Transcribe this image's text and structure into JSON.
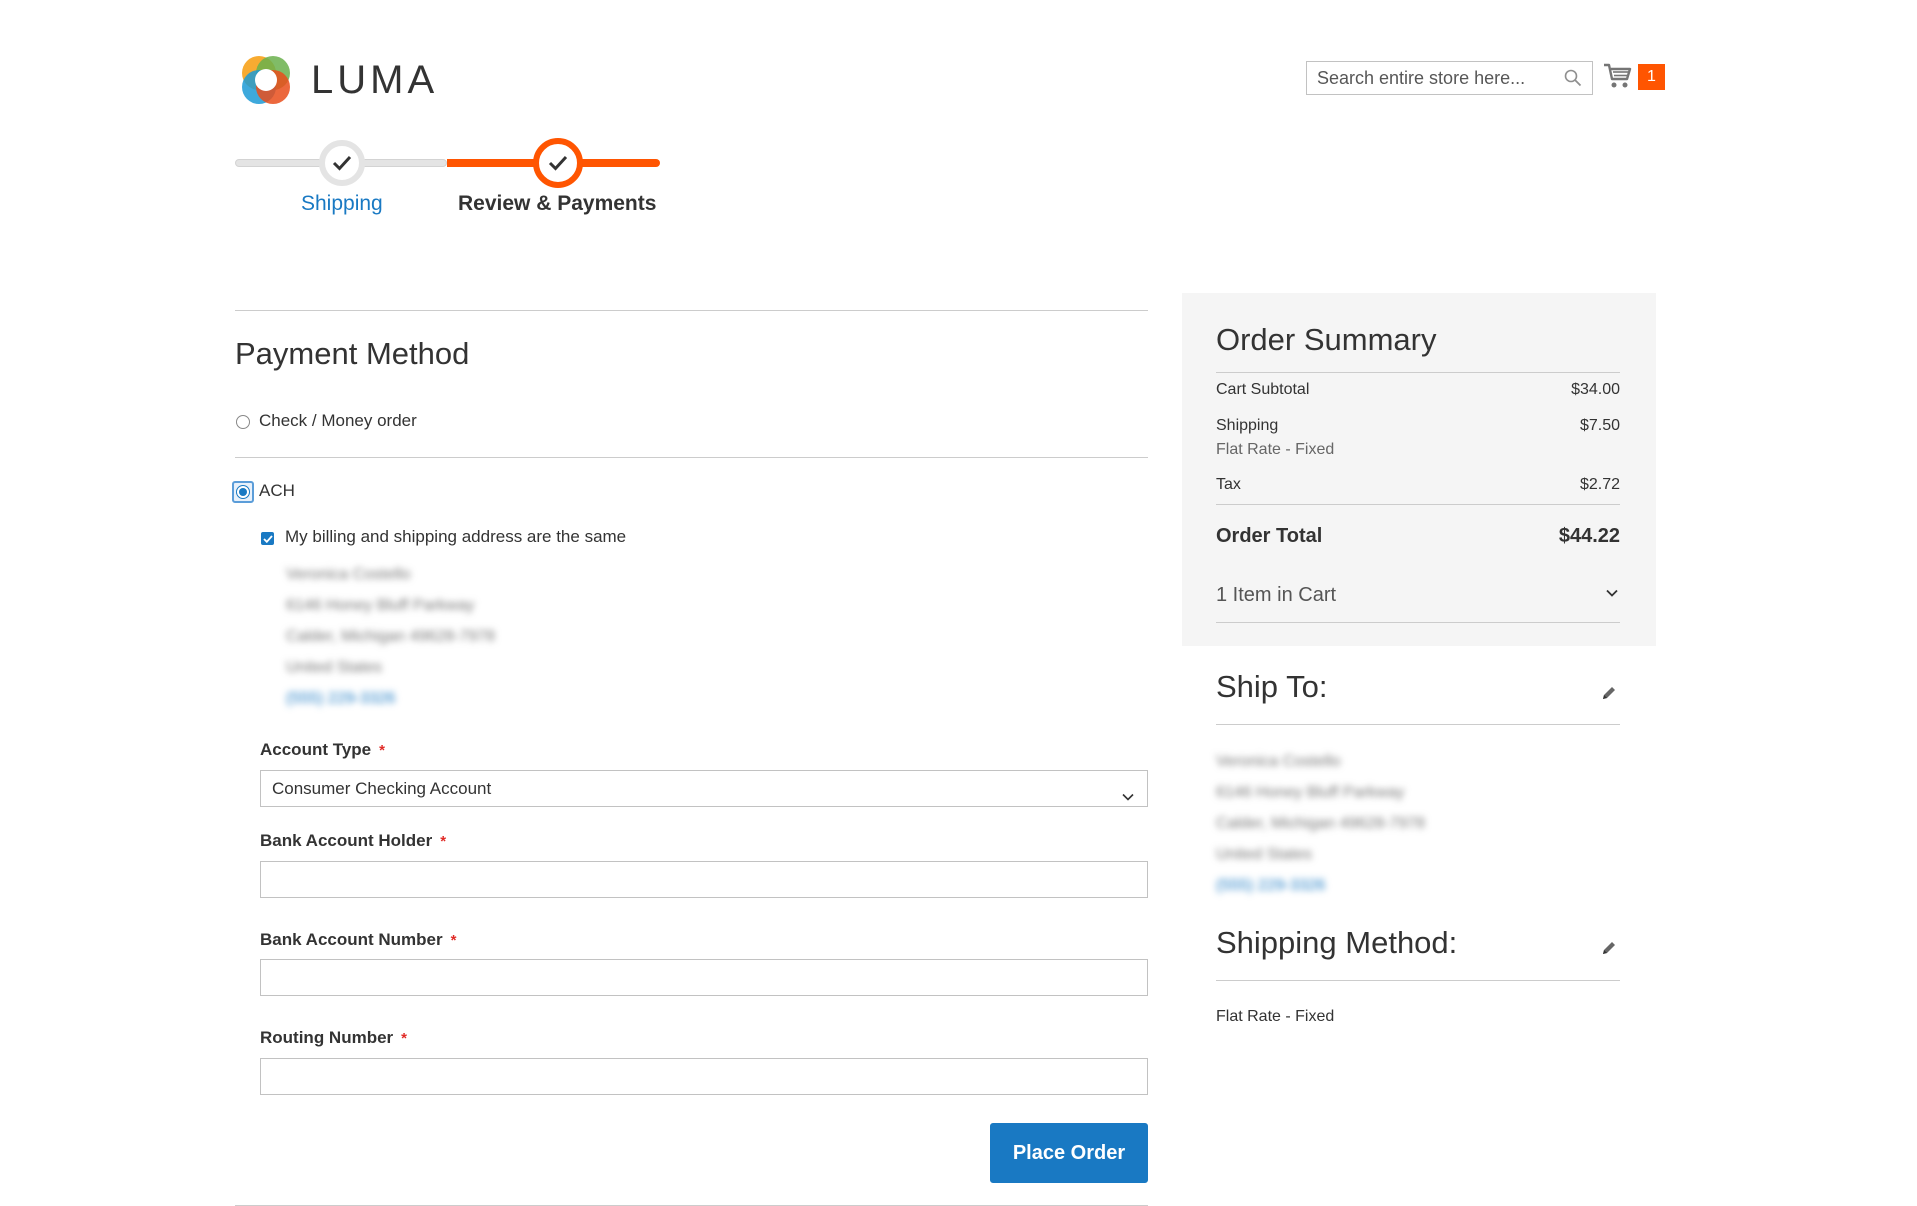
{
  "header": {
    "logo_text": "LUMA",
    "search": {
      "placeholder": "Search entire store here..."
    },
    "cart_count": "1"
  },
  "progress": {
    "steps": [
      {
        "label": "Shipping",
        "state": "complete"
      },
      {
        "label": "Review & Payments",
        "state": "active"
      }
    ]
  },
  "payment": {
    "title": "Payment Method",
    "methods": [
      {
        "label": "Check / Money order",
        "selected": false
      },
      {
        "label": "ACH",
        "selected": true
      }
    ],
    "same_address_label": "My billing and shipping address are the same",
    "billing_address": [
      "Veronica Costello",
      "6146 Honey Bluff Parkway",
      "Calder, Michigan 49628-7978",
      "United States",
      "(555) 229-3326"
    ],
    "account_type": {
      "label": "Account Type",
      "value": "Consumer Checking Account"
    },
    "bank_account_holder": {
      "label": "Bank Account Holder",
      "value": ""
    },
    "bank_account_number": {
      "label": "Bank Account Number",
      "value": ""
    },
    "routing_number": {
      "label": "Routing Number",
      "value": ""
    },
    "required_mark": "*",
    "place_order_label": "Place Order"
  },
  "summary": {
    "title": "Order Summary",
    "cart_subtotal": {
      "label": "Cart Subtotal",
      "value": "$34.00"
    },
    "shipping": {
      "label": "Shipping",
      "value": "$7.50",
      "method": "Flat Rate - Fixed"
    },
    "tax": {
      "label": "Tax",
      "value": "$2.72"
    },
    "order_total": {
      "label": "Order Total",
      "value": "$44.22"
    },
    "items_in_cart": "1 Item in Cart"
  },
  "ship_to": {
    "title": "Ship To:",
    "address": [
      "Veronica Costello",
      "6146 Honey Bluff Parkway",
      "Calder, Michigan 49628-7978",
      "United States",
      "(555) 229-3326"
    ]
  },
  "shipping_method": {
    "title": "Shipping Method:",
    "value": "Flat Rate - Fixed"
  },
  "colors": {
    "accent": "#ff5501",
    "link": "#1979c3",
    "required": "#e02b27"
  }
}
